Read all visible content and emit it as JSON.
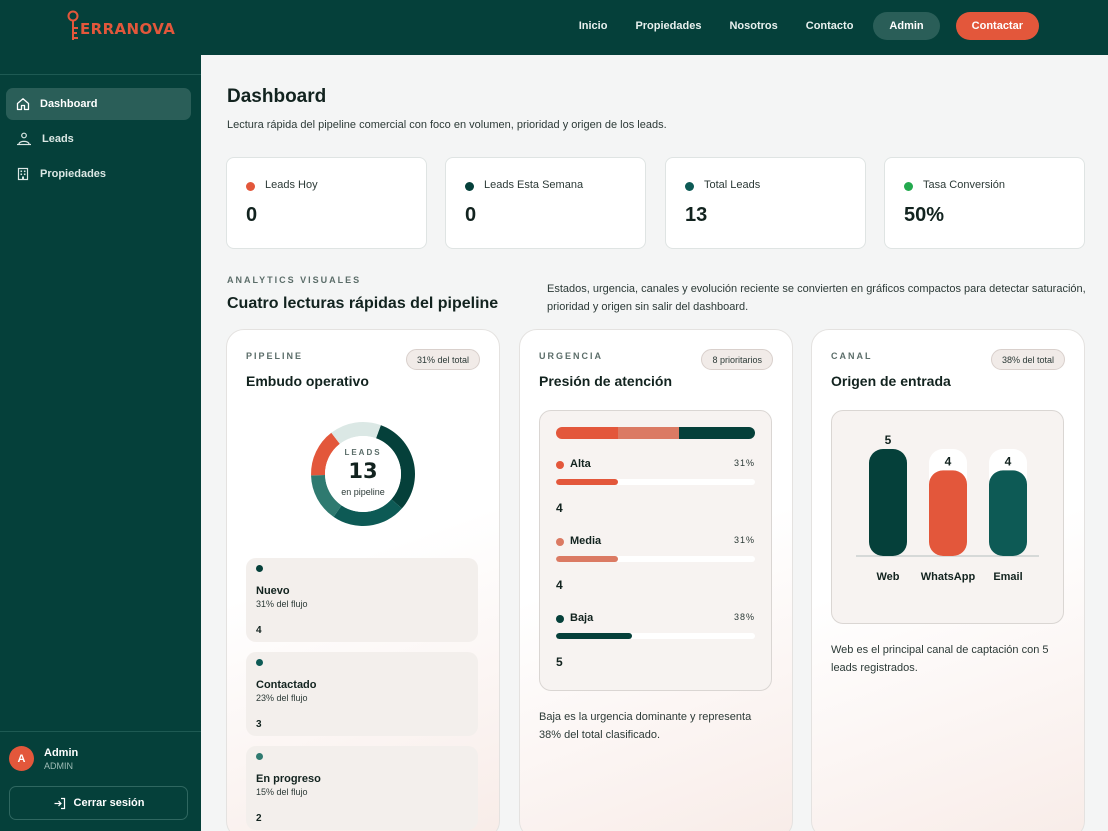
{
  "brand": {
    "logo_text": "ERRANOVA"
  },
  "nav": {
    "links": [
      "Inicio",
      "Propiedades",
      "Nosotros",
      "Contacto"
    ],
    "admin_label": "Admin",
    "cta_label": "Contactar"
  },
  "sidebar": {
    "items": [
      {
        "label": "Dashboard",
        "icon": "home-icon",
        "active": true
      },
      {
        "label": "Leads",
        "icon": "people-icon",
        "active": false
      },
      {
        "label": "Propiedades",
        "icon": "building-icon",
        "active": false
      }
    ],
    "user": {
      "initial": "A",
      "name": "Admin",
      "role": "ADMIN"
    },
    "logout_label": "Cerrar sesión"
  },
  "page": {
    "title": "Dashboard",
    "subtitle": "Lectura rápida del pipeline comercial con foco en volumen, prioridad y origen de los leads."
  },
  "kpis": [
    {
      "label": "Leads Hoy",
      "value": "0",
      "color": "#e3573b"
    },
    {
      "label": "Leads Esta Semana",
      "value": "0",
      "color": "#05403a"
    },
    {
      "label": "Total Leads",
      "value": "13",
      "color": "#0d5a55"
    },
    {
      "label": "Tasa Conversión",
      "value": "50%",
      "color": "#23a94e"
    }
  ],
  "analytics": {
    "kicker": "ANALYTICS VISUALES",
    "title": "Cuatro lecturas rápidas del pipeline",
    "description": "Estados, urgencia, canales y evolución reciente se convierten en gráficos compactos para detectar saturación, prioridad y origen sin salir del dashboard."
  },
  "pipeline": {
    "kicker": "PIPELINE",
    "title": "Embudo operativo",
    "pill": "31% del total",
    "donut": {
      "kicker": "LEADS",
      "value": "13",
      "sub": "en pipeline"
    },
    "stages": [
      {
        "name": "Nuevo",
        "pct_label": "31% del flujo",
        "count": "4",
        "fraction": 0.31,
        "color": "#05403a"
      },
      {
        "name": "Contactado",
        "pct_label": "23% del flujo",
        "count": "3",
        "fraction": 0.23,
        "color": "#0d5a55"
      },
      {
        "name": "En progreso",
        "pct_label": "15% del flujo",
        "count": "2",
        "fraction": 0.15,
        "color": "#2f7a70"
      }
    ],
    "donut_extra_segments": [
      {
        "fraction": 0.15,
        "color": "#e3573b"
      },
      {
        "fraction": 0.16,
        "color": "#dbe8e5"
      }
    ]
  },
  "urgency": {
    "kicker": "URGENCIA",
    "title": "Presión de atención",
    "pill": "8 prioritarios",
    "rows": [
      {
        "label": "Alta",
        "pct_label": "31%",
        "count": "4",
        "fraction": 0.31,
        "color": "#e3573b"
      },
      {
        "label": "Media",
        "pct_label": "31%",
        "count": "4",
        "fraction": 0.31,
        "color": "#db7a63"
      },
      {
        "label": "Baja",
        "pct_label": "38%",
        "count": "5",
        "fraction": 0.38,
        "color": "#05403a"
      }
    ],
    "note": "Baja es la urgencia dominante y representa 38% del total clasificado."
  },
  "channel": {
    "kicker": "CANAL",
    "title": "Origen de entrada",
    "pill": "38% del total",
    "note": "Web es el principal canal de captación con 5 leads registrados."
  },
  "chart_data": {
    "type": "bar",
    "categories": [
      "Web",
      "WhatsApp",
      "Email"
    ],
    "values": [
      5,
      4,
      4
    ],
    "colors": [
      "#05403a",
      "#e3573b",
      "#0d5a55"
    ],
    "ylim": [
      0,
      5
    ],
    "grid": false,
    "data_labels": true
  }
}
